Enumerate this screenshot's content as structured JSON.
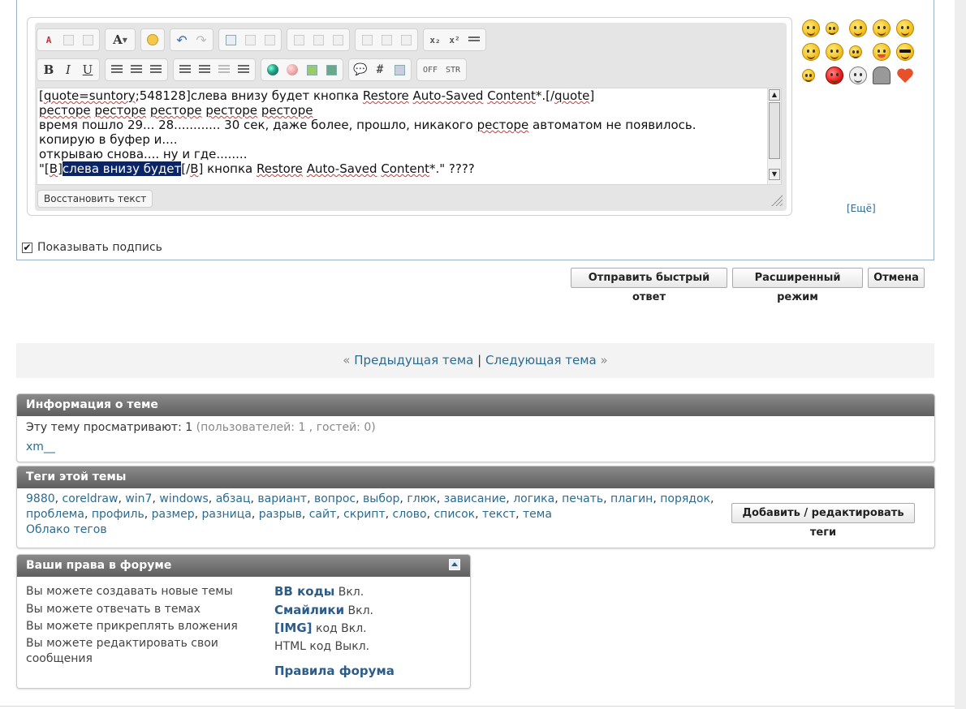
{
  "editor": {
    "toolbar_row1_labels": {
      "font": "A",
      "subscript": "x₂",
      "superscript": "x²"
    },
    "toolbar_row2_labels": {
      "bold": "B",
      "italic": "I",
      "underline": "U",
      "hash": "#",
      "off": "OFF",
      "str": "STR"
    },
    "lines": {
      "l1": {
        "a": "[",
        "b": "quote=suntory",
        "c": ";548128]слева внизу будет кнопка ",
        "d": "Restore",
        "e": " ",
        "f": "Auto-Saved",
        "g": " ",
        "h": "Content",
        "i": "*.[/",
        "j": "quote",
        "k": "]"
      },
      "l2": {
        "a": "ресторе",
        "b": " ",
        "c": "ресторе",
        "d": " ",
        "e": "ресторе",
        "f": " ",
        "g": "ресторе",
        "h": " ",
        "i": "ресторе"
      },
      "l3": {
        "a": "время пошло 29... 28............ 30 сек, даже более, прошло, никакого ",
        "b": "ресторе",
        "c": " автоматом не появилось."
      },
      "l4": "копирую в буфер и....",
      "l5": "открываю снова.... ну и где........",
      "l6": {
        "a": "\"[",
        "b": "B",
        "c": "]",
        "d": "слева внизу будет",
        "e": "[/",
        "f": "B",
        "g": "] кнопка ",
        "h": "Restore",
        "i": " ",
        "j": "Auto-Saved",
        "k": " ",
        "l": "Content",
        "m": "*.\" ????"
      }
    },
    "restore_button": "Восстановить текст",
    "more_smilies": "[Ещё]",
    "show_signature": "Показывать подпись",
    "show_signature_checked": true,
    "checkbox_mark": "✔"
  },
  "buttons": {
    "quick_reply": "Отправить быстрый ответ",
    "advanced": "Расширенный режим",
    "cancel": "Отмена"
  },
  "thread_nav": {
    "prev_arrow": "«",
    "prev": "Предыдущая тема",
    "separator": "|",
    "next": "Следующая тема",
    "next_arrow": "»"
  },
  "topic_info": {
    "title": "Информация о теме",
    "viewing_label": "Эту тему просматривают: 1",
    "viewing_detail": "(пользователей: 1 , гостей: 0)",
    "user": "xm__"
  },
  "tags": {
    "title": "Теги этой темы",
    "list": [
      "9880",
      "coreldraw",
      "win7",
      "windows",
      "абзац",
      "вариант",
      "вопрос",
      "выбор",
      "глюк",
      "зависание",
      "логика",
      "печать",
      "плагин",
      "порядок",
      "проблема",
      "профиль",
      "размер",
      "разница",
      "разрыв",
      "сайт",
      "скрипт",
      "слово",
      "список",
      "текст",
      "тема"
    ],
    "separator": ",",
    "cloud": "Облако тегов",
    "edit_button": "Добавить / редактировать теги"
  },
  "permissions": {
    "title": "Ваши права в форуме",
    "left": [
      "Вы можете создавать новые темы",
      "Вы можете отвечать в темах",
      "Вы можете прикреплять вложения",
      "Вы можете редактировать свои",
      "сообщения"
    ],
    "bb_link": "BB коды",
    "bb_state": "Вкл.",
    "smilies_link": "Смайлики",
    "smilies_state": "Вкл.",
    "img_link": "[IMG]",
    "img_state": "код Вкл.",
    "html_state": "HTML код Выкл.",
    "rules_link": "Правила форума"
  },
  "colors": {
    "link": "#2b6b91",
    "panel_header": "#6b6b6b",
    "selection": "#0a246a"
  }
}
